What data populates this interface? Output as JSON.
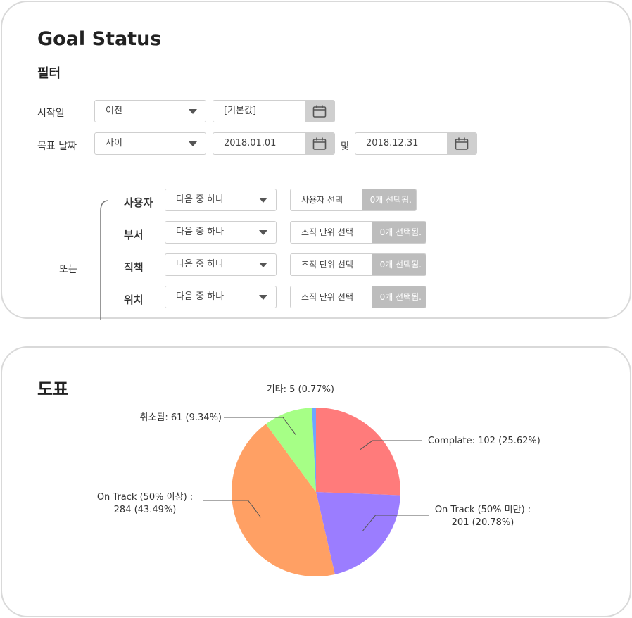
{
  "page": {
    "title": "Goal Status"
  },
  "filters": {
    "heading": "필터",
    "start_date": {
      "label": "시작일",
      "operator": "이전",
      "value": "[기본값]"
    },
    "target_date": {
      "label": "목표 날짜",
      "operator": "사이",
      "from": "2018.01.01",
      "and_text": "및",
      "to": "2018.12.31"
    },
    "or_label": "또는",
    "groups": [
      {
        "label": "사용자",
        "operator": "다음 중 하나",
        "picker": "사용자 선택",
        "count": "0개 선택됨."
      },
      {
        "label": "부서",
        "operator": "다음 중 하나",
        "picker": "조직 단위 선택",
        "count": "0개 선택됨."
      },
      {
        "label": "직책",
        "operator": "다음 중 하나",
        "picker": "조직 단위 선택",
        "count": "0개 선택됨."
      },
      {
        "label": "위치",
        "operator": "다음 중 하나",
        "picker": "조직 단위 선택",
        "count": "0개 선택됨."
      }
    ]
  },
  "chart": {
    "heading": "도표"
  },
  "chart_data": {
    "type": "pie",
    "slices": [
      {
        "label": "Complate: 102 (25.62%)",
        "value": 25.62,
        "color": "#ff7b7b"
      },
      {
        "label": "On Track (50% 미만) : 201 (20.78%)",
        "value": 20.78,
        "color": "#9b7dff"
      },
      {
        "label": "On Track (50% 이상) : 284 (43.49%)",
        "value": 43.49,
        "color": "#ffa064"
      },
      {
        "label": "취소됨: 61 (9.34%)",
        "value": 9.34,
        "color": "#a6ff86"
      },
      {
        "label": "기타: 5 (0.77%)",
        "value": 0.77,
        "color": "#6ea6ff"
      }
    ],
    "label_lines": [
      [
        "Complate: 102 (25.62%)"
      ],
      [
        "On Track (50% 미만) :",
        "201 (20.78%)"
      ],
      [
        "On Track (50% 이상) :",
        "284 (43.49%)"
      ],
      [
        "취소됨: 61 (9.34%)"
      ],
      [
        "기타: 5 (0.77%)"
      ]
    ]
  }
}
